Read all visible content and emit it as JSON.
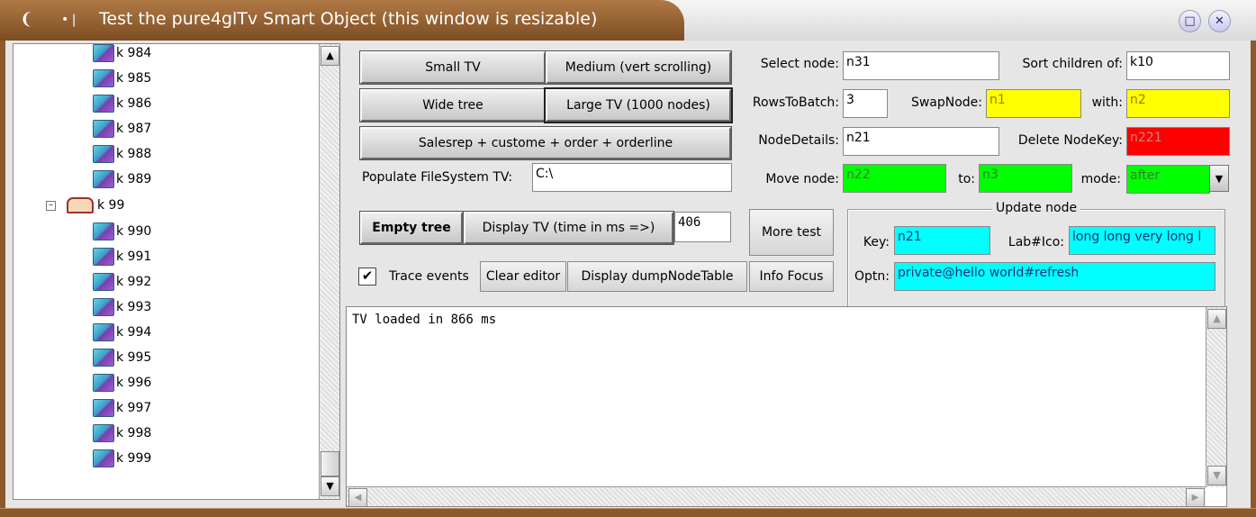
{
  "window": {
    "title": "Test the pure4glTv Smart Object   (this window is resizable)"
  },
  "tree": {
    "items_before": [
      "k 984",
      "k 985",
      "k 986",
      "k 987",
      "k 988",
      "k 989"
    ],
    "parent": "k 99",
    "items_after": [
      "k 990",
      "k 991",
      "k 992",
      "k 993",
      "k 994",
      "k 995",
      "k 996",
      "k 997",
      "k 998",
      "k 999"
    ]
  },
  "buttons": {
    "small_tv": "Small TV",
    "medium": "Medium (vert scrolling)",
    "wide_tree": "Wide tree",
    "large_tv": "Large TV (1000 nodes)",
    "salesrep": "Salesrep + custome + order + orderline",
    "empty_tree": "Empty tree",
    "display_tv": "Display TV  (time in ms =>)",
    "more_test": "More test",
    "clear_editor": "Clear editor",
    "display_dump": "Display dumpNodeTable",
    "info_focus": "Info Focus"
  },
  "populate": {
    "label": "Populate FileSystem TV:",
    "value": "C:\\"
  },
  "time_ms": "406",
  "trace_events": {
    "label": "Trace events",
    "checked": true
  },
  "fields": {
    "select_node": {
      "label": "Select node:",
      "value": "n31"
    },
    "sort_children": {
      "label": "Sort children of:",
      "value": "k10"
    },
    "rows_to_batch": {
      "label": "RowsToBatch:",
      "value": "3"
    },
    "swap_node": {
      "label": "SwapNode:",
      "value": "n1"
    },
    "swap_with": {
      "label": "with:",
      "value": "n2"
    },
    "node_details": {
      "label": "NodeDetails:",
      "value": "n21"
    },
    "delete_nodekey": {
      "label": "Delete NodeKey:",
      "value": "n221"
    },
    "move_node": {
      "label": "Move node:",
      "value": "n22"
    },
    "move_to": {
      "label": "to:",
      "value": "n3"
    },
    "mode": {
      "label": "mode:",
      "value": "after"
    }
  },
  "update_node": {
    "title": "Update node",
    "key": {
      "label": "Key:",
      "value": "n21"
    },
    "labico": {
      "label": "Lab#Ico:",
      "value": "long long very long l"
    },
    "optn": {
      "label": "Optn:",
      "value": "private@hello world#refresh"
    }
  },
  "editor": {
    "text": "TV loaded in 866 ms"
  },
  "colors": {
    "title_bar": "#8a5a2e",
    "yellow_field": "#ffff00",
    "red_field": "#ff0000",
    "green_field": "#00ff00",
    "cyan_field": "#00ffff"
  }
}
